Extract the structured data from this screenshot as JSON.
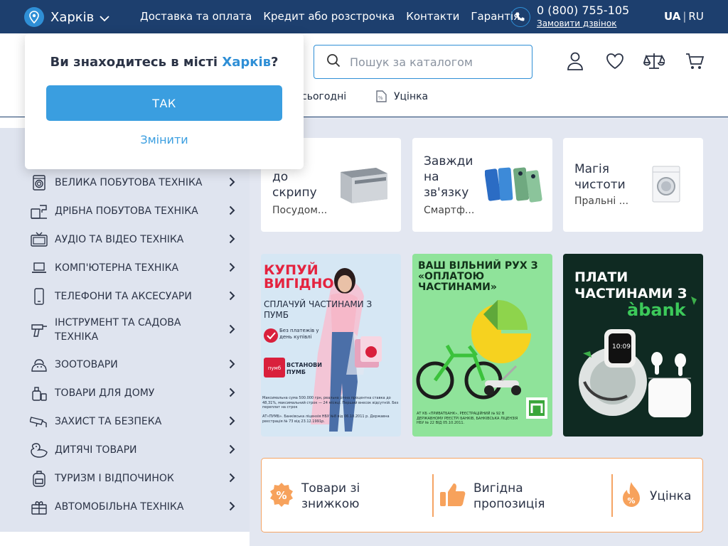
{
  "topbar": {
    "city": "Харків",
    "nav": [
      "Доставка та оплата",
      "Кредит або розстрочка",
      "Контакти",
      "Гарантія"
    ],
    "phone": "0 (800) 755-105",
    "callback": "Замовити дзвінок",
    "lang_active": "UA",
    "lang_sep": "|",
    "lang_other": "RU"
  },
  "search": {
    "placeholder": "Пошук за каталогом"
  },
  "header_icons": [
    "user-icon",
    "heart-icon",
    "scales-icon",
    "cart-icon"
  ],
  "subnav": {
    "item1_partial": "сьогодні",
    "item2": "Уцінка"
  },
  "popup": {
    "question_prefix": "Ви знаходитесь в місті ",
    "question_city": "Харків",
    "question_suffix": "?",
    "yes": "ТАК",
    "change": "Змінити"
  },
  "categories": [
    {
      "label": "ВЕЛИКА ПОБУТОВА ТЕХНІКА",
      "icon": "washer-icon"
    },
    {
      "label": "ДРІБНА ПОБУТОВА ТЕХНІКА",
      "icon": "coffee-machine-icon"
    },
    {
      "label": "АУДІО ТА ВІДЕО ТЕХНІКА",
      "icon": "tv-icon"
    },
    {
      "label": "КОМП'ЮТЕРНА ТЕХНІКА",
      "icon": "laptop-icon"
    },
    {
      "label": "ТЕЛЕФОНИ ТА АКСЕСУАРИ",
      "icon": "phone-icon"
    },
    {
      "label": "ІНСТРУМЕНТ ТА САДОВА ТЕХНІКА",
      "icon": "drill-icon"
    },
    {
      "label": "ЗООТОВАРИ",
      "icon": "pet-icon"
    },
    {
      "label": "ТОВАРИ ДЛЯ ДОМУ",
      "icon": "home-goods-icon"
    },
    {
      "label": "ЗАХИСТ ТА БЕЗПЕКА",
      "icon": "camera-icon"
    },
    {
      "label": "ДИТЯЧІ ТОВАРИ",
      "icon": "duck-icon"
    },
    {
      "label": "ТУРИЗМ І ВІДПОЧИНОК",
      "icon": "backpack-icon"
    },
    {
      "label": "АВТОМОБІЛЬНА ТЕХНІКА",
      "icon": "car-icon"
    }
  ],
  "cards": [
    {
      "title": "ота\nдо\nскрипу",
      "sub": "Посудом..."
    },
    {
      "title": "Завжди\nна\nзв'язку",
      "sub": "Смартф..."
    },
    {
      "title": "Магія\nчистоти",
      "sub": "Пральні ..."
    }
  ],
  "banners": {
    "pumb": {
      "headline": "КУПУЙ ВИГІДНО",
      "sub": "СПЛАЧУЙ ЧАСТИНАМИ З ПУМБ",
      "badge": "Без платежів у день купівлі",
      "logo": "пумб",
      "cta": "ВСТАНОВИ ПУМБ",
      "fine1": "Максимальна сума 500.000 грн, реальна річна процентна ставка до 48,31%, максимальний строк — 24 місяці. Перший внесок відсутній. Без переплат на строк",
      "fine2": "АТ«ПУМБ». Банківська ліцензія НБУ №8 від 06.10.2011 р. Державна реєстрація № 73 від 23.12.1991р."
    },
    "privat": {
      "headline": "ВАШ ВІЛЬНИЙ РУХ З «ОПЛАТОЮ ЧАСТИНАМИ»",
      "fine": "АТ КБ «ПРИВАТБАНК», РЕЄСТРАЦІЙНИЙ № 92 В ДЕРЖАВНОМУ РЕЄСТРІ БАНКІВ, БАНКІВСЬКА ЛІЦЕНЗІЯ НБУ № 22 ВІД 05.10.2011."
    },
    "abank": {
      "headline": "ПЛАТИ ЧАСТИНАМИ З",
      "brand": "àbank",
      "watch_time": "10:09"
    }
  },
  "promo": [
    {
      "label": "Товари зі знижкою",
      "icon": "percent-badge-icon"
    },
    {
      "label": "Вигідна пропозиція",
      "icon": "thumbs-up-icon"
    },
    {
      "label": "Уцінка",
      "icon": "flame-percent-icon"
    }
  ],
  "colors": {
    "topbar": "#1d3f6e",
    "accent": "#3a9ee0",
    "promo_border": "#f5a464",
    "sidebar_bg": "#dfe4ef"
  }
}
